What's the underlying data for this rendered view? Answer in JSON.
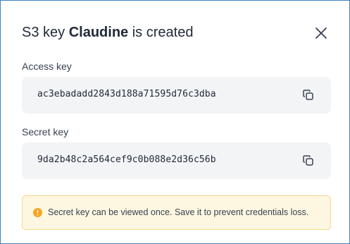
{
  "dialog": {
    "title_prefix": "S3 key",
    "title_name": "Claudine",
    "title_suffix": "is created",
    "close_icon": "close-icon"
  },
  "access_key": {
    "label": "Access key",
    "value": "ac3ebadadd2843d188a71595d76c3dba",
    "copy_icon": "copy-icon"
  },
  "secret_key": {
    "label": "Secret key",
    "value": "9da2b48c2a564cef9c0b088e2d36c56b",
    "copy_icon": "copy-icon"
  },
  "warning": {
    "icon": "warning-circle-icon",
    "text": "Secret key can be viewed once. Save it to prevent credentials loss.",
    "color": "#f5a623"
  },
  "colors": {
    "border": "#3b82c4",
    "field_background": "#f3f4f6",
    "warning_background": "#fdf7e1",
    "warning_border": "#f3d98a"
  }
}
